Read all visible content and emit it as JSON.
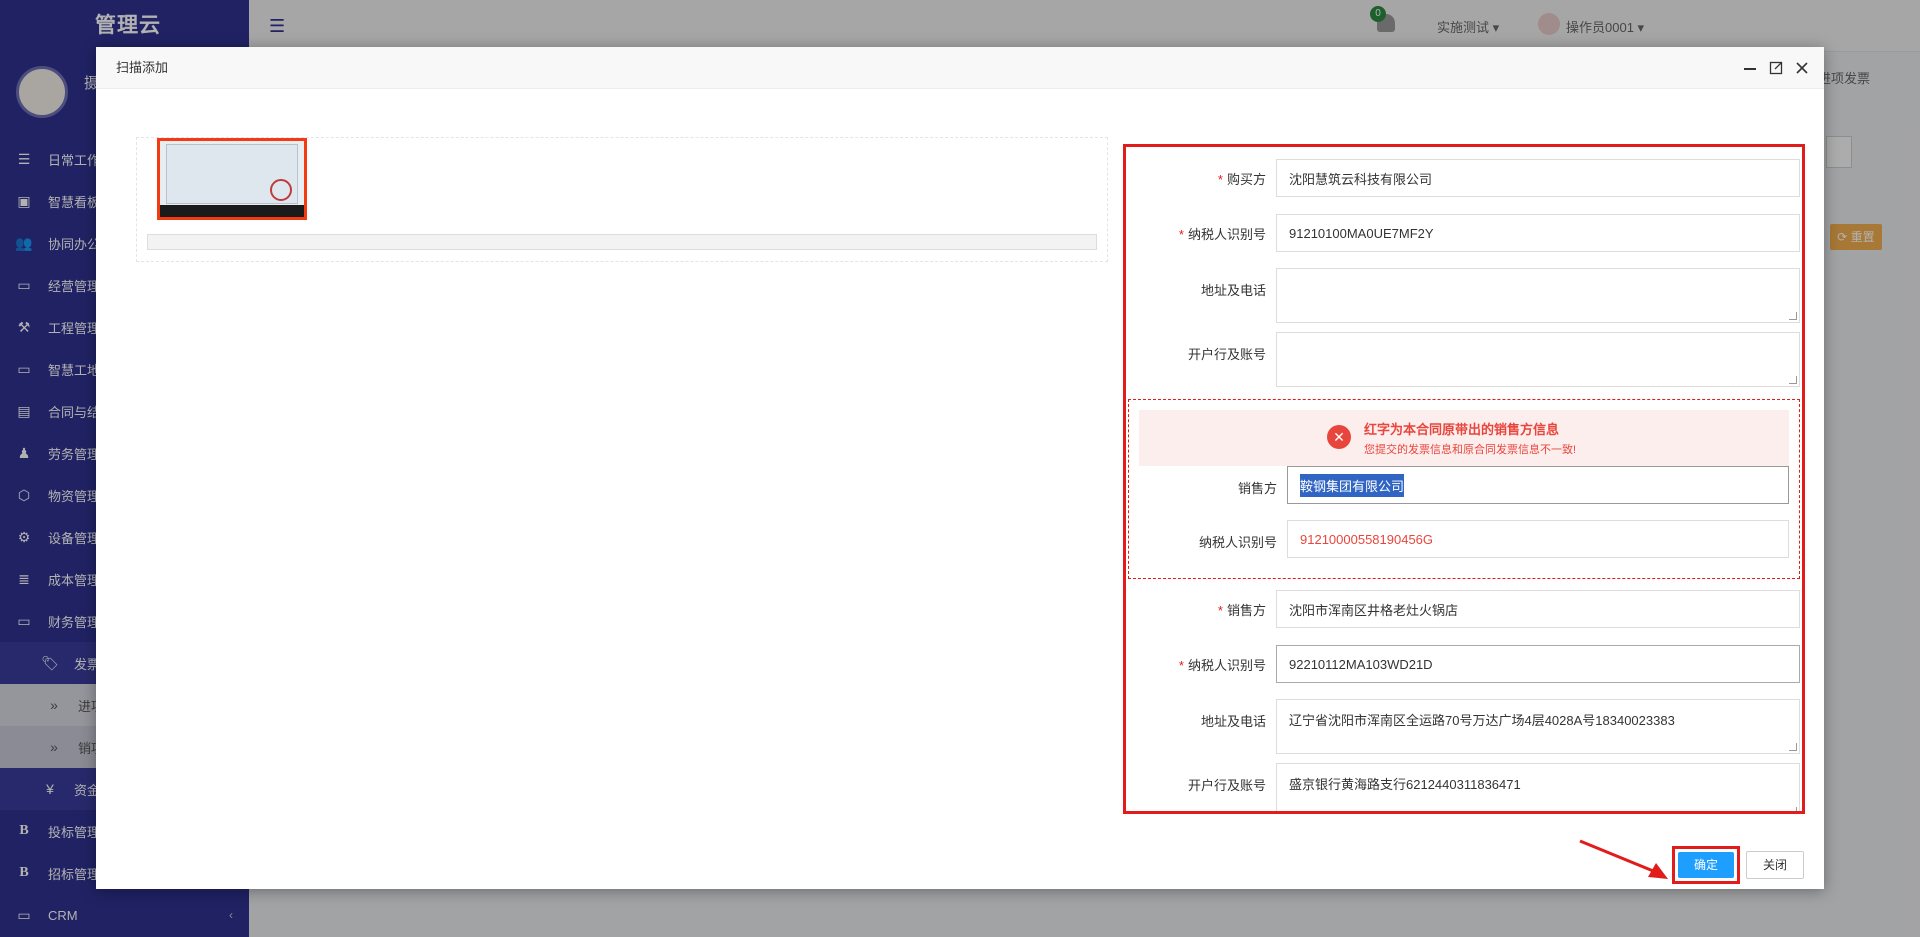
{
  "app": {
    "brand": "管理云",
    "user_short": "摄",
    "top_menu_project": "实施测试",
    "top_menu_user": "操作员0001",
    "bell_count": "0",
    "breadcrumb_tail": "› 进项发票",
    "bg_reset_label": "⟳ 重置"
  },
  "sidebar": {
    "items": [
      {
        "icon": "☰",
        "label": "日常工作"
      },
      {
        "icon": "▣",
        "label": "智慧看板"
      },
      {
        "icon": "👥",
        "label": "协同办公"
      },
      {
        "icon": "▭",
        "label": "经营管理"
      },
      {
        "icon": "⚒",
        "label": "工程管理"
      },
      {
        "icon": "▭",
        "label": "智慧工地"
      },
      {
        "icon": "▤",
        "label": "合同与结算"
      },
      {
        "icon": "♟",
        "label": "劳务管理"
      },
      {
        "icon": "⬡",
        "label": "物资管理"
      },
      {
        "icon": "⚙",
        "label": "设备管理"
      },
      {
        "icon": "≣",
        "label": "成本管理"
      },
      {
        "icon": "▭",
        "label": "财务管理"
      }
    ],
    "sub_invoice": "发票",
    "sub_incoming": "进项",
    "sub_outgoing": "销项",
    "sub_funds": "资金",
    "bottom": [
      {
        "icon": "B",
        "label": "投标管理"
      },
      {
        "icon": "B",
        "label": "招标管理"
      },
      {
        "icon": "▭",
        "label": "CRM"
      }
    ]
  },
  "modal": {
    "title": "扫描添加",
    "form": {
      "buyer_label": "购买方",
      "buyer_value": "沈阳慧筑云科技有限公司",
      "buyer_tax_label": "纳税人识别号",
      "buyer_tax_value": "91210100MA0UE7MF2Y",
      "buyer_addr_label": "地址及电话",
      "buyer_addr_value": "",
      "buyer_bank_label": "开户行及账号",
      "buyer_bank_value": "",
      "alert_title": "红字为本合同原带出的销售方信息",
      "alert_sub": "您提交的发票信息和原合同发票信息不一致!",
      "contract_seller_label": "销售方",
      "contract_seller_value": "鞍钢集团有限公司",
      "contract_tax_label": "纳税人识别号",
      "contract_tax_value": "91210000558190456G",
      "seller_label": "销售方",
      "seller_value": "沈阳市浑南区井格老灶火锅店",
      "seller_tax_label": "纳税人识别号",
      "seller_tax_value": "92210112MA103WD21D",
      "seller_addr_label": "地址及电话",
      "seller_addr_value": "辽宁省沈阳市浑南区全运路70号万达广场4层4028A号18340023383",
      "seller_bank_label": "开户行及账号",
      "seller_bank_value": "盛京银行黄海路支行6212440311836471"
    },
    "ok_label": "确定",
    "close_label": "关闭"
  },
  "colors": {
    "sidebar": "#2f3190",
    "highlight_border": "#e21b1b",
    "primary": "#1e9fff",
    "error": "#e8463c"
  }
}
